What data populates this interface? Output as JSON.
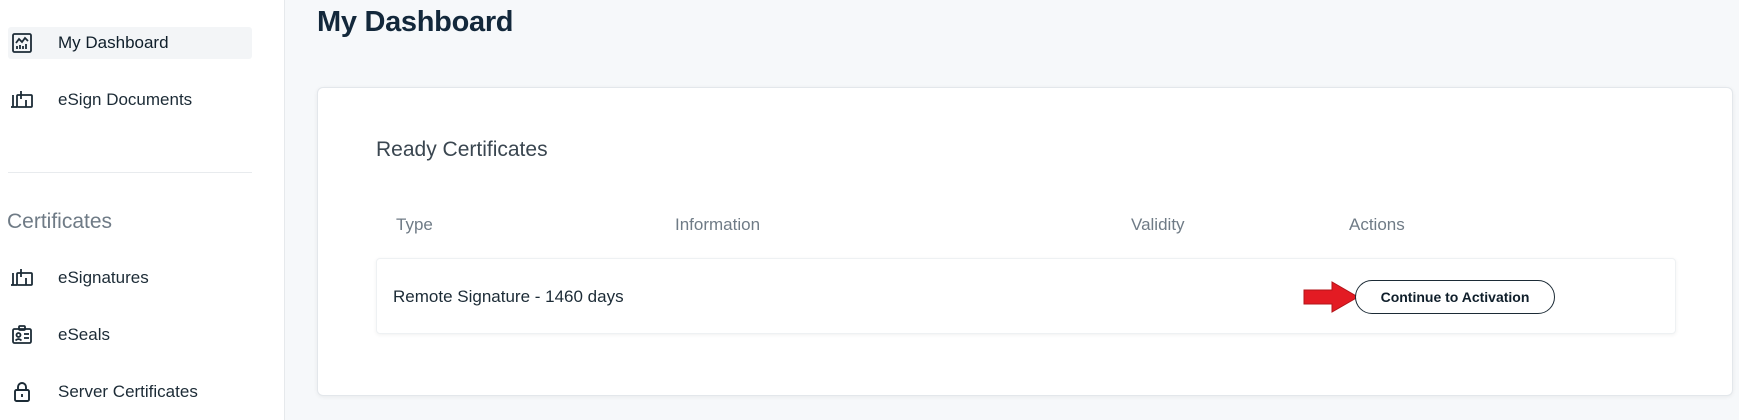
{
  "sidebar": {
    "items": [
      {
        "label": "My Dashboard",
        "icon": "dashboard-chart-icon"
      },
      {
        "label": "eSign Documents",
        "icon": "document-sign-icon"
      }
    ],
    "section_heading": "Certificates",
    "certificate_items": [
      {
        "label": "eSignatures",
        "icon": "signature-icon"
      },
      {
        "label": "eSeals",
        "icon": "seal-badge-icon"
      },
      {
        "label": "Server Certificates",
        "icon": "lock-icon"
      }
    ]
  },
  "main": {
    "title": "My Dashboard",
    "card": {
      "title": "Ready Certificates",
      "columns": [
        "Type",
        "Information",
        "Validity",
        "Actions"
      ],
      "rows": [
        {
          "type": "Remote Signature - 1460 days",
          "information": "",
          "validity": "",
          "action_label": "Continue to Activation"
        }
      ]
    }
  },
  "colors": {
    "accent_arrow": "#e31b23",
    "text_dark": "#13283b",
    "muted": "#6f7b86"
  }
}
